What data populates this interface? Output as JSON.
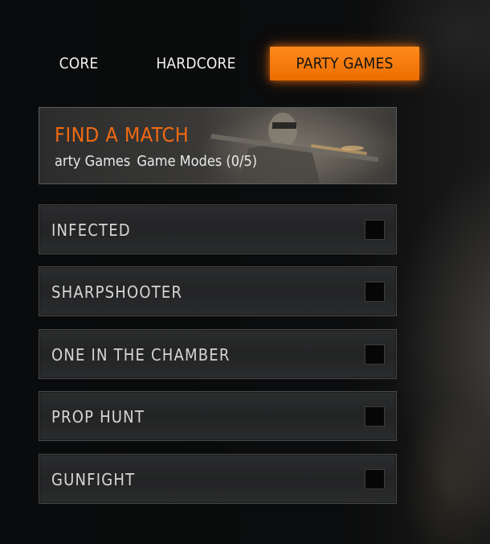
{
  "tabs": [
    {
      "label": "CORE"
    },
    {
      "label": "HARDCORE"
    },
    {
      "label": "PARTY GAMES",
      "selected": true
    }
  ],
  "banner": {
    "title": "FIND A MATCH",
    "subtitle_part1": "arty Games",
    "subtitle_part2": "Game Modes (0/5)"
  },
  "modes": [
    {
      "label": "INFECTED",
      "checked": false
    },
    {
      "label": "SHARPSHOOTER",
      "checked": false
    },
    {
      "label": "ONE IN THE CHAMBER",
      "checked": false
    },
    {
      "label": "PROP HUNT",
      "checked": false
    },
    {
      "label": "GUNFIGHT",
      "checked": false
    }
  ],
  "colors": {
    "accent": "#ff7a0a",
    "banner_title": "#f26a12"
  }
}
